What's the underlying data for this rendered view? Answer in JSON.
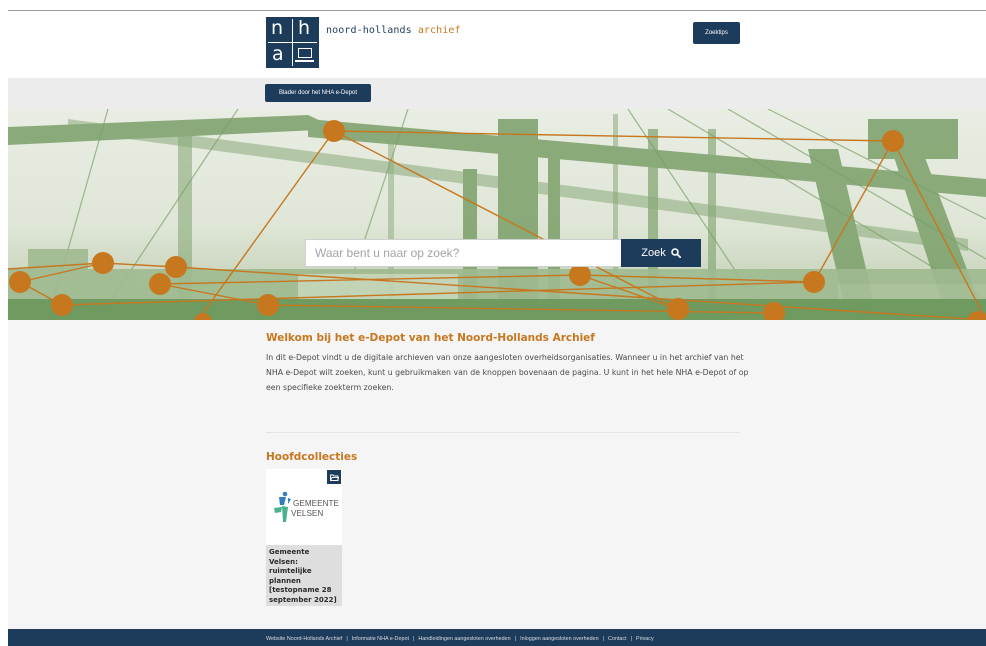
{
  "header": {
    "logo_letters": [
      "n",
      "h",
      "a"
    ],
    "brand_part1": "noord-hollands",
    "brand_part2": "archief",
    "zoektips_label": "Zoektips"
  },
  "nav": {
    "blader_label": "Blader door het NHA e-Depot"
  },
  "search": {
    "placeholder": "Waar bent u naar op zoek?",
    "button_label": "Zoek"
  },
  "welcome": {
    "title": "Welkom bij het e-Depot van het Noord-Hollands Archief",
    "text": "In dit e-Depot vindt u de digitale archieven van onze aangesloten overheidsorganisaties. Wanneer u in het archief van het NHA e-Depot wilt zoeken, kunt u gebruikmaken van de knoppen bovenaan de pagina. U kunt in het hele NHA e-Depot of op een specifieke zoekterm zoeken."
  },
  "collections": {
    "title": "Hoofdcollecties",
    "items": [
      {
        "logo_line1": "GEMEENTE",
        "logo_line2": "VELSEN",
        "caption": "Gemeente Velsen: ruimtelijke plannen [testopname 28 september 2022]"
      }
    ]
  },
  "footer": {
    "links": [
      "Website Noord-Hollands Archief",
      "Informatie NHA e-Depot",
      "Handleidingen aangesloten overheden",
      "Inloggen aangesloten overheden",
      "Contact",
      "Privacy"
    ],
    "separator": "|"
  },
  "colors": {
    "navy": "#1d3b5b",
    "accent_orange": "#c7771e",
    "hero_green": "#6f9a60",
    "network_node": "#c7771e"
  },
  "icons": {
    "search": "search-icon",
    "folder": "folder-open-icon"
  }
}
